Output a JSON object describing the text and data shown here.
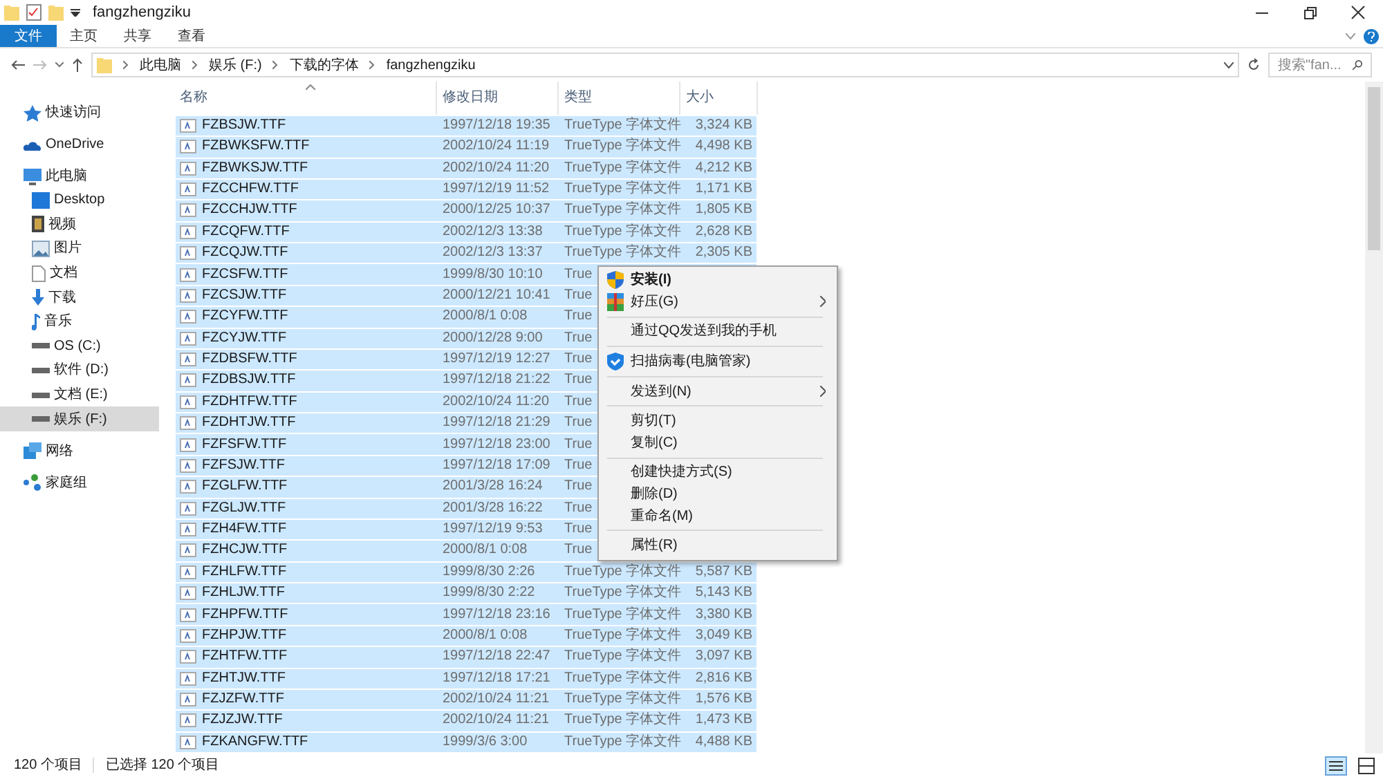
{
  "window": {
    "title": "fangzhengziku"
  },
  "ribbon_tabs": [
    {
      "label": "文件",
      "selected": true
    },
    {
      "label": "主页",
      "selected": false
    },
    {
      "label": "共享",
      "selected": false
    },
    {
      "label": "查看",
      "selected": false
    }
  ],
  "breadcrumb": [
    "此电脑",
    "娱乐 (F:)",
    "下载的字体",
    "fangzhengziku"
  ],
  "search": {
    "placeholder": "搜索\"fan..."
  },
  "sidebar": {
    "items": [
      {
        "label": "快速访问",
        "selected": false
      },
      {
        "label": "OneDrive",
        "selected": false
      },
      {
        "label": "此电脑",
        "selected": false,
        "children": [
          {
            "label": "Desktop",
            "selected": false
          },
          {
            "label": "视频",
            "selected": false
          },
          {
            "label": "图片",
            "selected": false
          },
          {
            "label": "文档",
            "selected": false
          },
          {
            "label": "下载",
            "selected": false
          },
          {
            "label": "音乐",
            "selected": false
          },
          {
            "label": "OS (C:)",
            "selected": false
          },
          {
            "label": "软件 (D:)",
            "selected": false
          },
          {
            "label": "文档 (E:)",
            "selected": false
          },
          {
            "label": "娱乐 (F:)",
            "selected": true
          }
        ]
      },
      {
        "label": "网络",
        "selected": false
      },
      {
        "label": "家庭组",
        "selected": false
      }
    ]
  },
  "table": {
    "columns": [
      "名称",
      "修改日期",
      "类型",
      "大小"
    ],
    "rows": [
      {
        "name": "FZBSJW.TTF",
        "date": "1997/12/18 19:35",
        "type": "TrueType 字体文件",
        "size": "3,324 KB",
        "selected": true
      },
      {
        "name": "FZBWKSFW.TTF",
        "date": "2002/10/24 11:19",
        "type": "TrueType 字体文件",
        "size": "4,498 KB",
        "selected": true
      },
      {
        "name": "FZBWKSJW.TTF",
        "date": "2002/10/24 11:20",
        "type": "TrueType 字体文件",
        "size": "4,212 KB",
        "selected": true
      },
      {
        "name": "FZCCHFW.TTF",
        "date": "1997/12/19 11:52",
        "type": "TrueType 字体文件",
        "size": "1,171 KB",
        "selected": true
      },
      {
        "name": "FZCCHJW.TTF",
        "date": "2000/12/25 10:37",
        "type": "TrueType 字体文件",
        "size": "1,805 KB",
        "selected": true
      },
      {
        "name": "FZCQFW.TTF",
        "date": "2002/12/3 13:38",
        "type": "TrueType 字体文件",
        "size": "2,628 KB",
        "selected": true
      },
      {
        "name": "FZCQJW.TTF",
        "date": "2002/12/3 13:37",
        "type": "TrueType 字体文件",
        "size": "2,305 KB",
        "selected": true
      },
      {
        "name": "FZCSFW.TTF",
        "date": "1999/8/30 10:10",
        "type": "True",
        "selected": true
      },
      {
        "name": "FZCSJW.TTF",
        "date": "2000/12/21 10:41",
        "type": "True",
        "selected": true
      },
      {
        "name": "FZCYFW.TTF",
        "date": "2000/8/1 0:08",
        "type": "True",
        "selected": true
      },
      {
        "name": "FZCYJW.TTF",
        "date": "2000/12/28 9:00",
        "type": "True",
        "selected": true
      },
      {
        "name": "FZDBSFW.TTF",
        "date": "1997/12/19 12:27",
        "type": "True",
        "selected": true
      },
      {
        "name": "FZDBSJW.TTF",
        "date": "1997/12/18 21:22",
        "type": "True",
        "selected": true
      },
      {
        "name": "FZDHTFW.TTF",
        "date": "2002/10/24 11:20",
        "type": "True",
        "selected": true
      },
      {
        "name": "FZDHTJW.TTF",
        "date": "1997/12/18 21:29",
        "type": "True",
        "selected": true
      },
      {
        "name": "FZFSFW.TTF",
        "date": "1997/12/18 23:00",
        "type": "True",
        "selected": true
      },
      {
        "name": "FZFSJW.TTF",
        "date": "1997/12/18 17:09",
        "type": "True",
        "selected": true
      },
      {
        "name": "FZGLFW.TTF",
        "date": "2001/3/28 16:24",
        "type": "True",
        "selected": true
      },
      {
        "name": "FZGLJW.TTF",
        "date": "2001/3/28 16:22",
        "type": "True",
        "selected": true
      },
      {
        "name": "FZH4FW.TTF",
        "date": "1997/12/19 9:53",
        "type": "True",
        "selected": true
      },
      {
        "name": "FZHCJW.TTF",
        "date": "2000/8/1 0:08",
        "type": "True",
        "selected": true
      },
      {
        "name": "FZHLFW.TTF",
        "date": "1999/8/30 2:26",
        "type": "TrueType 字体文件",
        "size": "5,587 KB",
        "selected": true
      },
      {
        "name": "FZHLJW.TTF",
        "date": "1999/8/30 2:22",
        "type": "TrueType 字体文件",
        "size": "5,143 KB",
        "selected": true
      },
      {
        "name": "FZHPFW.TTF",
        "date": "1997/12/18 23:16",
        "type": "TrueType 字体文件",
        "size": "3,380 KB",
        "selected": true
      },
      {
        "name": "FZHPJW.TTF",
        "date": "2000/8/1 0:08",
        "type": "TrueType 字体文件",
        "size": "3,049 KB",
        "selected": true
      },
      {
        "name": "FZHTFW.TTF",
        "date": "1997/12/18 22:47",
        "type": "TrueType 字体文件",
        "size": "3,097 KB",
        "selected": true
      },
      {
        "name": "FZHTJW.TTF",
        "date": "1997/12/18 17:21",
        "type": "TrueType 字体文件",
        "size": "2,816 KB",
        "selected": true
      },
      {
        "name": "FZJZFW.TTF",
        "date": "2002/10/24 11:21",
        "type": "TrueType 字体文件",
        "size": "1,576 KB",
        "selected": true
      },
      {
        "name": "FZJZJW.TTF",
        "date": "2002/10/24 11:21",
        "type": "TrueType 字体文件",
        "size": "1,473 KB",
        "selected": true
      },
      {
        "name": "FZKANGFW.TTF",
        "date": "1999/3/6 3:00",
        "type": "TrueType 字体文件",
        "size": "4,488 KB",
        "selected": true
      }
    ]
  },
  "context_menu": [
    {
      "kind": "item",
      "label": "安装(I)",
      "bold": true,
      "submenu": false
    },
    {
      "kind": "item",
      "label": "好压(G)",
      "bold": false,
      "submenu": true
    },
    {
      "kind": "separator"
    },
    {
      "kind": "item",
      "label": "通过QQ发送到我的手机",
      "bold": false,
      "submenu": false
    },
    {
      "kind": "separator"
    },
    {
      "kind": "item",
      "label": "扫描病毒(电脑管家)",
      "bold": false,
      "submenu": false
    },
    {
      "kind": "separator"
    },
    {
      "kind": "item",
      "label": "发送到(N)",
      "bold": false,
      "submenu": true
    },
    {
      "kind": "separator"
    },
    {
      "kind": "item",
      "label": "剪切(T)",
      "bold": false,
      "submenu": false
    },
    {
      "kind": "item",
      "label": "复制(C)",
      "bold": false,
      "submenu": false
    },
    {
      "kind": "separator"
    },
    {
      "kind": "item",
      "label": "创建快捷方式(S)",
      "bold": false,
      "submenu": false
    },
    {
      "kind": "item",
      "label": "删除(D)",
      "bold": false,
      "submenu": false
    },
    {
      "kind": "item",
      "label": "重命名(M)",
      "bold": false,
      "submenu": false
    },
    {
      "kind": "separator"
    },
    {
      "kind": "item",
      "label": "属性(R)",
      "bold": false,
      "submenu": false
    }
  ],
  "status_bar": {
    "count": "120 个项目",
    "selection": "已选择 120 个项目"
  }
}
